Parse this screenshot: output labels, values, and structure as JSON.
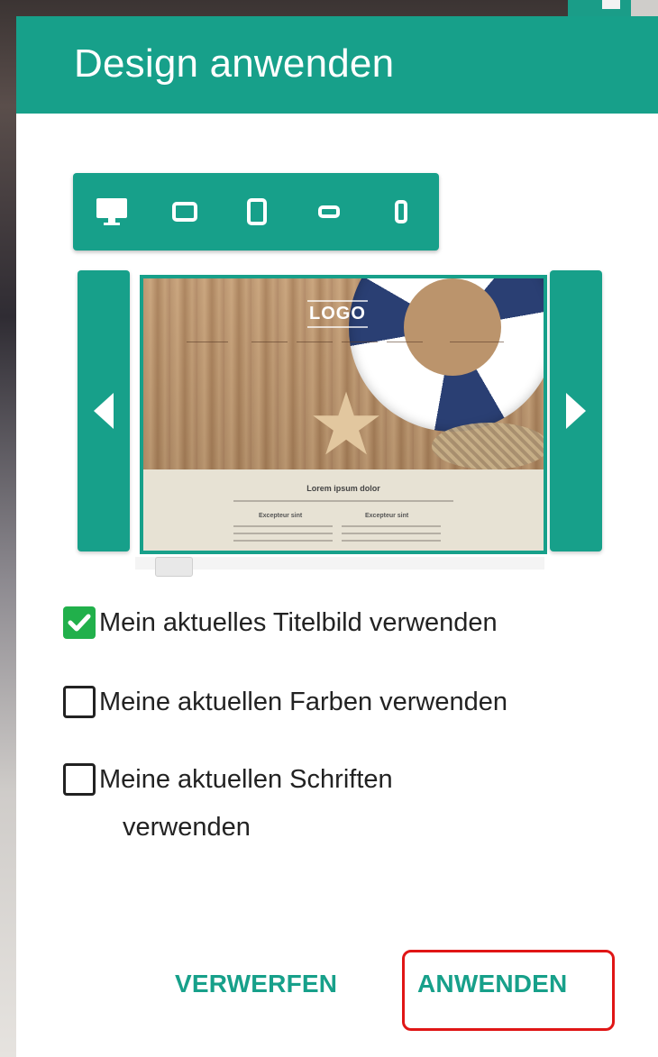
{
  "dialog": {
    "title": "Design anwenden",
    "device_icons": [
      "desktop-icon",
      "tablet-landscape-icon",
      "tablet-portrait-icon",
      "phone-landscape-icon",
      "phone-portrait-icon"
    ],
    "preview": {
      "logo_text": "LOGO",
      "heading": "Lorem ipsum dolor",
      "sub_left": "Excepteur sint",
      "sub_right": "Excepteur sint"
    },
    "options": [
      {
        "label": "Mein aktuelles Titelbild verwenden",
        "checked": true
      },
      {
        "label": "Meine aktuellen Farben verwenden",
        "checked": false
      },
      {
        "label_line1": "Meine aktuellen Schriften",
        "label_line2": "verwenden",
        "checked": false
      }
    ],
    "buttons": {
      "discard": "VERWERFEN",
      "apply": "ANWENDEN"
    }
  },
  "colors": {
    "accent": "#17a08a",
    "checkbox_checked": "#21b04b",
    "highlight": "#e01616"
  }
}
